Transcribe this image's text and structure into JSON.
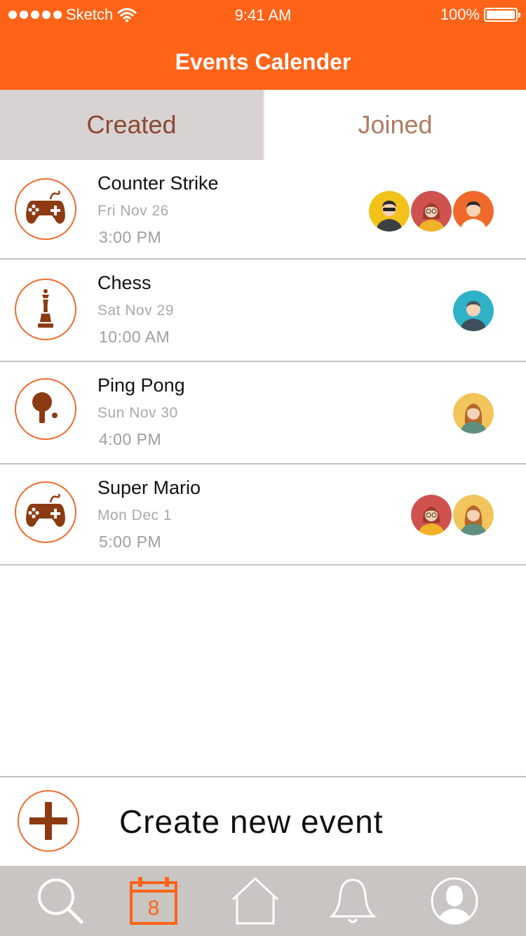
{
  "status_bar": {
    "carrier": "Sketch",
    "time": "9:41 AM",
    "battery": "100%"
  },
  "header": {
    "title": "Events Calender"
  },
  "tabs": [
    {
      "label": "Created",
      "active": true
    },
    {
      "label": "Joined",
      "active": false
    }
  ],
  "events": [
    {
      "title": "Counter Strike",
      "date": "Fri  Nov 26",
      "time": "3:00 PM",
      "icon": "gamepad-icon",
      "participants": [
        "man-sunglasses-avatar",
        "woman-red-hair-avatar",
        "man-orange-avatar"
      ]
    },
    {
      "title": "Chess",
      "date": "Sat  Nov 29",
      "time": "10:00 AM",
      "icon": "chess-king-icon",
      "participants": [
        "man-teal-avatar"
      ]
    },
    {
      "title": "Ping Pong",
      "date": "Sun  Nov 30",
      "time": "4:00 PM",
      "icon": "ping-pong-paddle-icon",
      "participants": [
        "woman-yellow-avatar"
      ]
    },
    {
      "title": "Super Mario",
      "date": "Mon  Dec 1",
      "time": "5:00 PM",
      "icon": "gamepad-icon",
      "participants": [
        "woman-red-hair-avatar",
        "woman-yellow-avatar"
      ]
    }
  ],
  "create_event": {
    "label": "Create new event",
    "icon": "plus-icon"
  },
  "tab_bar": {
    "items": [
      {
        "icon": "search-icon"
      },
      {
        "icon": "calendar-icon",
        "badge": "8",
        "active": true
      },
      {
        "icon": "home-icon"
      },
      {
        "icon": "bell-icon"
      },
      {
        "icon": "profile-icon"
      }
    ]
  },
  "colors": {
    "brand": "#ff6317",
    "icon_brown": "#8c3a12",
    "tab_active_bg": "#d9d2d2",
    "tab_bar_bg": "#c8c5c3"
  }
}
